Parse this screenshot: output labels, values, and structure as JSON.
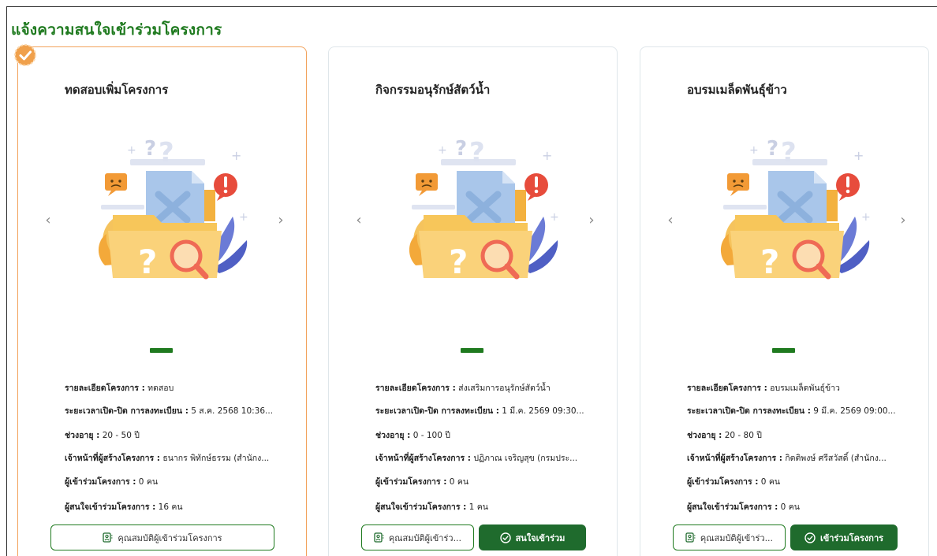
{
  "page": {
    "title": "แจ้งความสนใจเข้าร่วมโครงการ"
  },
  "nav": {
    "prev_glyph": "‹",
    "next_glyph": "›"
  },
  "labels": {
    "detail": "รายละเอียดโครงการ :",
    "period": "ระยะเวลาเปิด-ปิด การลงทะเบียน :",
    "age": "ช่วงอายุ :",
    "staff": "เจ้าหน้าที่ผู้สร้างโครงการ :",
    "participants": "ผู้เข้าร่วมโครงการ :",
    "interested": "ผู้สนใจเข้าร่วมโครงการ :"
  },
  "colors": {
    "accent": "#1f7a1f",
    "button": "#1f6b2d",
    "selected_border": "#f2a25b"
  },
  "cards": [
    {
      "title": "ทดสอบเพิ่มโครงการ",
      "selected": true,
      "detail": "ทดสอบ",
      "period": "5 ส.ค. 2568 10:36...",
      "age": "20 - 50 ปี",
      "staff": "ธนากร พิทักษ์ธรรม (สำนักง...",
      "participants": "0 คน",
      "interested": "16 คน",
      "qualification_button": "คุณสมบัติผู้เข้าร่วมโครงการ",
      "action_button": ""
    },
    {
      "title": "กิจกรรมอนุรักษ์สัตว์น้ำ",
      "selected": false,
      "detail": "ส่งเสริมการอนุรักษ์สัตว์น้ำ",
      "period": "1 มี.ค. 2569 09:30...",
      "age": "0 - 100 ปี",
      "staff": "ปฏิภาณ เจริญสุข (กรมประ...",
      "participants": "0 คน",
      "interested": "1 คน",
      "qualification_button": "คุณสมบัติผู้เข้าร่ว...",
      "action_button": "สนใจเข้าร่วม"
    },
    {
      "title": "อบรมเมล็ดพันธุ์ข้าว",
      "selected": false,
      "detail": "อบรมเมล็ดพันธุ์ข้าว",
      "period": "9 มี.ค. 2569 09:00...",
      "age": "20 - 80 ปี",
      "staff": "กิตติพงษ์ ศรีสวัสดิ์ (สำนักง...",
      "participants": "0 คน",
      "interested": "0 คน",
      "qualification_button": "คุณสมบัติผู้เข้าร่ว...",
      "action_button": "เข้าร่วมโครงการ"
    }
  ]
}
